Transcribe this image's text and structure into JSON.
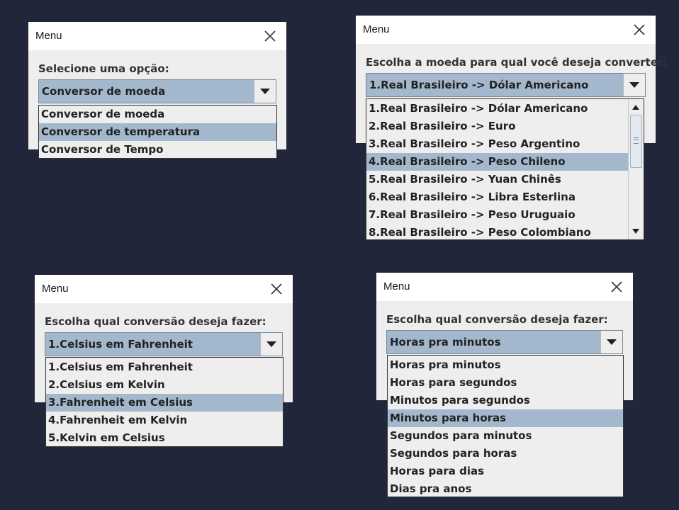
{
  "dialogs": [
    {
      "title": "Menu",
      "prompt": "Selecione uma opção:",
      "selected_value": "Conversor de moeda",
      "options": [
        "Conversor de moeda",
        "Conversor de temperatura",
        "Conversor de Tempo"
      ],
      "highlighted": "Conversor de temperatura"
    },
    {
      "title": "Menu",
      "prompt": "Escolha a moeda para qual você deseja converter:",
      "selected_value": "1.Real Brasileiro -> Dólar Americano",
      "options": [
        "1.Real Brasileiro -> Dólar Americano",
        "2.Real Brasileiro -> Euro",
        "3.Real Brasileiro -> Peso Argentino",
        "4.Real Brasileiro -> Peso Chileno",
        "5.Real Brasileiro -> Yuan Chinês",
        "6.Real Brasileiro -> Libra Esterlina",
        "7.Real Brasileiro -> Peso Uruguaio",
        "8.Real Brasileiro -> Peso Colombiano"
      ],
      "highlighted": "4.Real Brasileiro -> Peso Chileno"
    },
    {
      "title": "Menu",
      "prompt": "Escolha qual conversão deseja fazer:",
      "selected_value": "1.Celsius em Fahrenheit",
      "options": [
        "1.Celsius em Fahrenheit",
        "2.Celsius em Kelvin",
        "3.Fahrenheit em Celsius",
        "4.Fahrenheit em Kelvin",
        "5.Kelvin em Celsius"
      ],
      "highlighted": "3.Fahrenheit em Celsius"
    },
    {
      "title": "Menu",
      "prompt": "Escolha qual conversão deseja fazer:",
      "selected_value": "Horas pra minutos",
      "options": [
        "Horas pra minutos",
        "Horas para segundos",
        "Minutos para segundos",
        "Minutos para horas",
        "Segundos para minutos",
        "Segundos para horas",
        "Horas para dias",
        "Dias pra anos"
      ],
      "highlighted": "Minutos para horas"
    }
  ],
  "colors": {
    "background": "#22263a",
    "selection": "#a3b8cc",
    "dialog": "#eeeeee"
  },
  "icons": {
    "close": "close-icon",
    "dropdown": "chevron-down-icon"
  }
}
